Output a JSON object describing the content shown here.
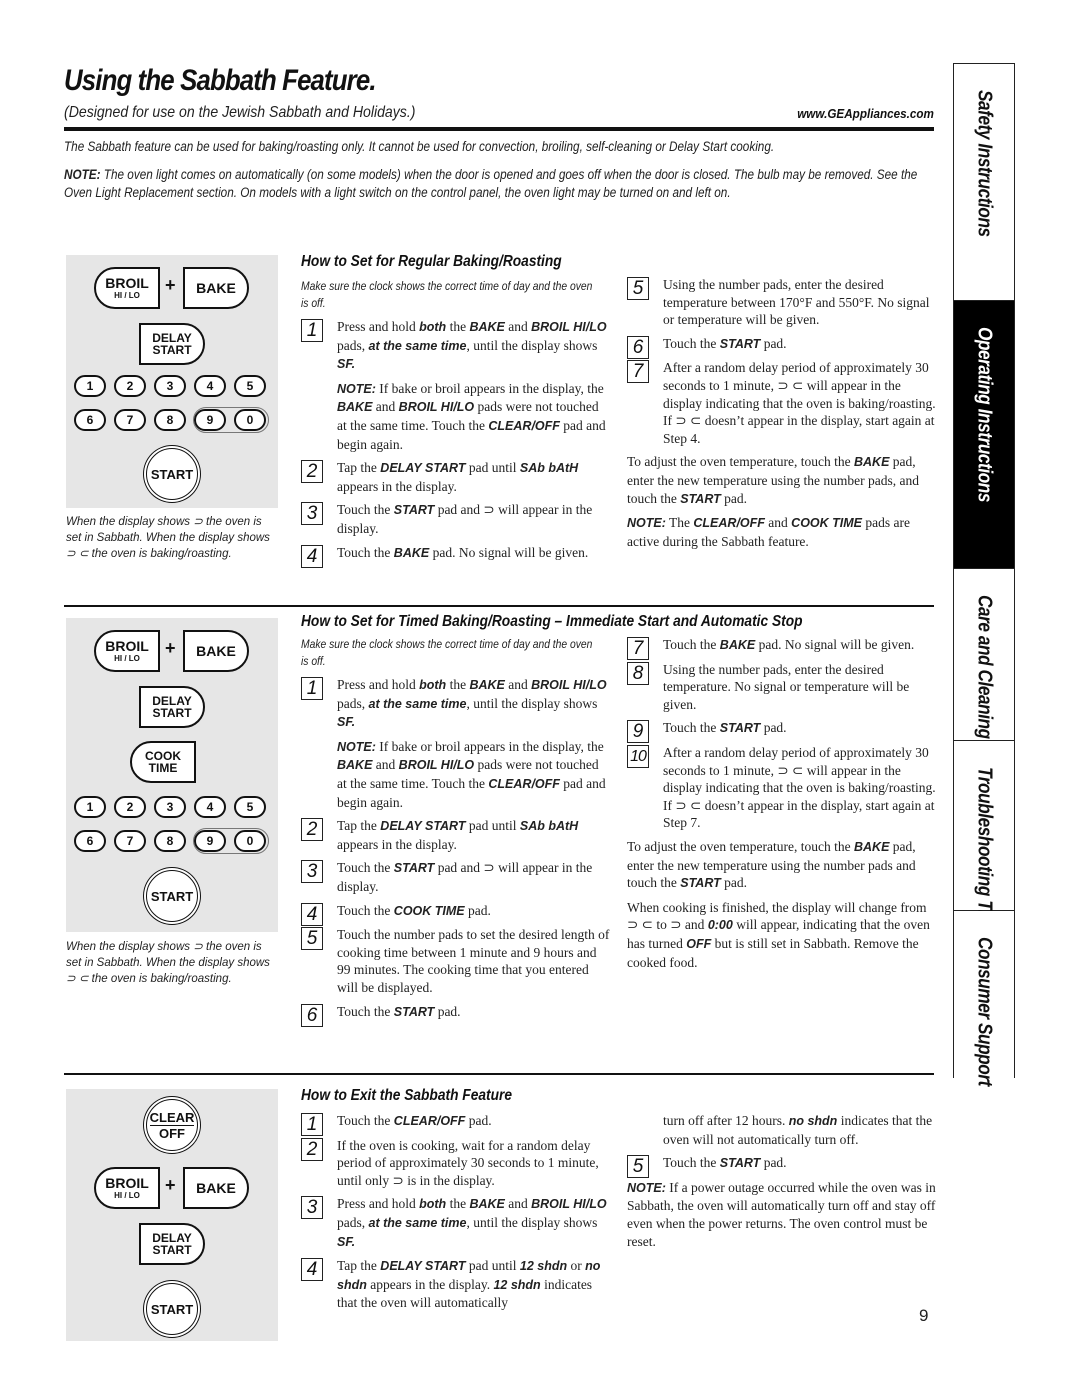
{
  "header": {
    "title": "Using the Sabbath Feature.",
    "subtitle": "(Designed for use on the Jewish Sabbath and Holidays.)",
    "website": "www.GEAppliances.com"
  },
  "intro": {
    "paragraph": "The Sabbath feature can be used for baking/roasting only. It cannot be used for convection, broiling, self-cleaning or Delay Start cooking.",
    "note_label": "NOTE:",
    "note_text": " The oven light comes on automatically (on some models) when the door is opened and goes off when the door is closed. The bulb may be removed. See the Oven Light Replacement section. On models with a light switch on the control panel, the oven light may be turned on and left on."
  },
  "keypad": {
    "broil": "BROIL",
    "broil_sub": "HI / LO",
    "plus": "+",
    "bake": "BAKE",
    "delay_1": "DELAY",
    "delay_2": "START",
    "cook_1": "COOK",
    "cook_2": "TIME",
    "clear_1": "CLEAR",
    "clear_2": "OFF",
    "start": "START",
    "numbers": [
      "1",
      "2",
      "3",
      "4",
      "5",
      "6",
      "7",
      "8",
      "9",
      "0"
    ]
  },
  "caption": "When the display shows ⊃ the oven is set in Sabbath. When the display shows ⊃ ⊂  the oven is baking/roasting.",
  "section1": {
    "heading": "How to Set for Regular Baking/Roasting",
    "note": "Make sure the clock shows the correct time of day and the oven is off.",
    "steps": [
      {
        "n": "1",
        "html": "Press and hold <b>both</b> the <b>BAKE</b> and <b>BROIL HI/LO</b> pads, <b>at the same time</b>, until the display shows <b>SF.</b>"
      },
      {
        "n": "",
        "html": "<b>NOTE:</b> If bake or broil appears in the display, the <b>BAKE</b> and <b>BROIL HI/LO</b> pads were not touched at the same time. Touch the <b>CLEAR/OFF</b> pad and begin again."
      },
      {
        "n": "2",
        "html": "Tap the <b>DELAY START</b> pad until <b>SAb bAtH</b> appears in the display."
      },
      {
        "n": "3",
        "html": "Touch the <b>START</b> pad and ⊃ will appear in the display."
      },
      {
        "n": "4",
        "html": "Touch the <b>BAKE</b> pad. No signal will be given."
      }
    ],
    "steps_right": [
      {
        "n": "5",
        "html": "Using the number pads, enter the desired temperature between 170°F and 550°F. No signal or temperature will be given."
      },
      {
        "n": "6",
        "html": "Touch the <b>START</b> pad."
      },
      {
        "n": "7",
        "html": "After a random delay period of approximately 30 seconds to 1 minute, ⊃ ⊂ will appear in the display indicating that the oven is baking/roasting. If ⊃ ⊂ doesn’t appear in the display, start again at Step 4."
      }
    ],
    "paras": [
      "To adjust the oven temperature, touch the <b>BAKE</b> pad, enter the new temperature using the number pads, and touch the <b>START</b> pad.",
      "<b>NOTE:</b> The <b>CLEAR/OFF</b> and <b>COOK TIME</b> pads are active during the Sabbath feature."
    ]
  },
  "section2": {
    "heading": "How to Set for Timed Baking/Roasting – Immediate Start and Automatic Stop",
    "note": "Make sure the clock shows the correct time of day and the oven is off.",
    "steps": [
      {
        "n": "1",
        "html": "Press and hold <b>both</b> the <b>BAKE</b> and <b>BROIL HI/LO</b> pads, <b>at the same time</b>, until the display shows <b>SF.</b>"
      },
      {
        "n": "",
        "html": "<b>NOTE:</b> If bake or broil appears in the display, the <b>BAKE</b> and <b>BROIL HI/LO</b> pads were not touched at the same time. Touch the <b>CLEAR/OFF</b> pad and begin again."
      },
      {
        "n": "2",
        "html": "Tap the <b>DELAY START</b> pad until <b>SAb bAtH</b> appears in the display."
      },
      {
        "n": "3",
        "html": "Touch the <b>START</b> pad and ⊃ will appear in the display."
      },
      {
        "n": "4",
        "html": "Touch the <b>COOK TIME</b> pad."
      },
      {
        "n": "5",
        "html": "Touch the number pads to set the desired length of cooking time between 1 minute and 9 hours and 99 minutes. The cooking time that you entered will be displayed."
      },
      {
        "n": "6",
        "html": "Touch the <b>START</b> pad."
      }
    ],
    "steps_right": [
      {
        "n": "7",
        "html": "Touch the <b>BAKE</b> pad. No signal will be given."
      },
      {
        "n": "8",
        "html": "Using the number pads, enter the desired temperature. No signal or temperature will be given."
      },
      {
        "n": "9",
        "html": "Touch the <b>START</b> pad."
      },
      {
        "n": "10",
        "html": "After a random delay period of approximately 30 seconds to 1 minute, ⊃ ⊂ will appear in the display indicating that the oven is baking/roasting. If ⊃ ⊂ doesn’t appear in the display, start again at Step 7."
      }
    ],
    "paras": [
      "To adjust the oven temperature, touch the <b>BAKE</b> pad, enter the new temperature using the number pads and touch the <b>START</b> pad.",
      "When cooking is finished, the display will change from ⊃ ⊂ to ⊃ and <b>0:00</b> will appear, indicating that the oven has turned <b>OFF</b> but is still set in Sabbath. Remove the cooked food."
    ]
  },
  "section3": {
    "heading": "How to Exit the Sabbath Feature",
    "steps": [
      {
        "n": "1",
        "html": "Touch the <b>CLEAR/OFF</b> pad."
      },
      {
        "n": "2",
        "html": "If the oven is cooking, wait for a random delay period of approximately 30 seconds to 1 minute, until only ⊃ is in the display."
      },
      {
        "n": "3",
        "html": "Press and hold <b>both</b> the <b>BAKE</b> and <b>BROIL HI/LO</b> pads, <b>at the same time</b>, until the display shows <b>SF.</b>"
      },
      {
        "n": "4",
        "html": "Tap the <b>DELAY START</b> pad until <b>12 shdn</b> or <b>no shdn</b> appears in the display. <b>12 shdn</b> indicates that the oven will automatically"
      }
    ],
    "steps_right": [
      {
        "n": "",
        "html": "turn off after 12 hours. <b>no shdn</b> indicates that the oven will not automatically turn off."
      },
      {
        "n": "5",
        "html": "Touch the <b>START</b> pad."
      }
    ],
    "paras": [
      "<b>NOTE:</b> If a power outage occurred while the oven was in Sabbath, the oven will automatically turn off and stay off even when the power returns. The oven control must be reset."
    ]
  },
  "tabs": [
    {
      "label": "Safety Instructions",
      "active": false
    },
    {
      "label": "Operating Instructions",
      "active": true
    },
    {
      "label": "Care and Cleaning",
      "active": false
    },
    {
      "label": "Troubleshooting Tips",
      "active": false
    },
    {
      "label": "Consumer Support",
      "active": false
    }
  ],
  "page_number": "9"
}
